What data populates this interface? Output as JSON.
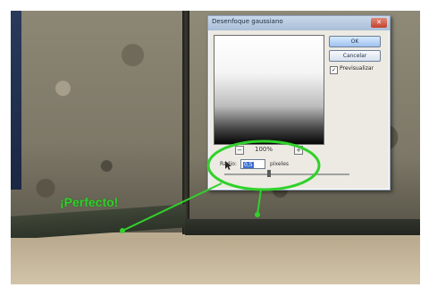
{
  "dialog": {
    "title": "Desenfoque gaussiano",
    "ok_label": "OK",
    "cancel_label": "Cancelar",
    "preview_label": "Previsualizar",
    "zoom_label": "100%",
    "radius_label": "Radio:",
    "radius_value": "0,5",
    "radius_unit": "píxeles"
  },
  "annotation": {
    "text": "¡Perfecto!",
    "color": "#31d12b"
  }
}
